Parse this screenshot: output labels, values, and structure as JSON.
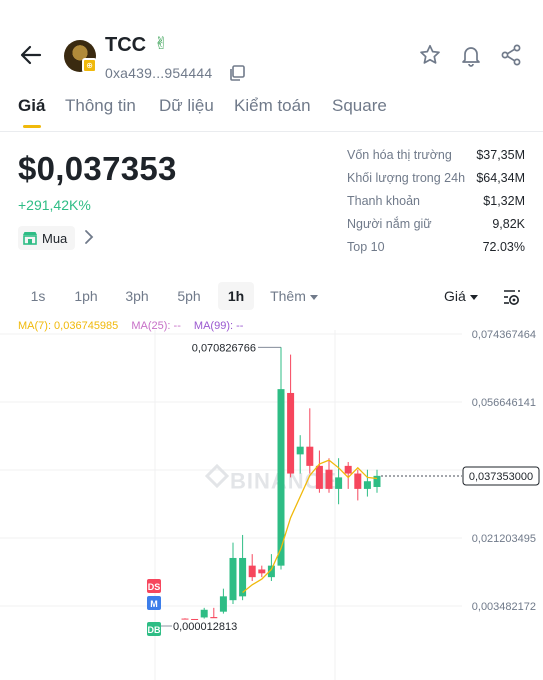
{
  "header": {
    "token_name": "TCC",
    "address": "0xa439...954444",
    "badge_glyph": "⊕",
    "hand_glyph": "✌"
  },
  "tabs": [
    {
      "label": "Giá",
      "active": true
    },
    {
      "label": "Thông tin",
      "active": false
    },
    {
      "label": "Dữ liệu",
      "active": false
    },
    {
      "label": "Kiểm toán",
      "active": false
    },
    {
      "label": "Square",
      "active": false
    }
  ],
  "price": {
    "value": "$0,037353",
    "change": "+291,42K%",
    "buy_label": "Mua"
  },
  "stats": [
    {
      "label": "Vốn hóa thị trường",
      "value": "$37,35M"
    },
    {
      "label": "Khối lượng trong 24h",
      "value": "$64,34M"
    },
    {
      "label": "Thanh khoản",
      "value": "$1,32M"
    },
    {
      "label": "Người nắm giữ",
      "value": "9,82K"
    },
    {
      "label": "Top 10",
      "value": "72.03%"
    }
  ],
  "intervals": [
    {
      "label": "1s",
      "active": false
    },
    {
      "label": "1ph",
      "active": false
    },
    {
      "label": "3ph",
      "active": false
    },
    {
      "label": "5ph",
      "active": false
    },
    {
      "label": "1h",
      "active": true
    },
    {
      "label": "Thêm",
      "active": false
    }
  ],
  "price_selector": "Giá",
  "ma": {
    "ma7": "MA(7): 0,036745985",
    "ma25": "MA(25): --",
    "ma99": "MA(99): --"
  },
  "colors": {
    "up": "#2ebd85",
    "down": "#f6465d",
    "accent": "#f0b90b",
    "ma7": "#f0b90b",
    "ma25": "#c770c7",
    "ma99": "#9b59d0",
    "marker_ds": "#f6465d",
    "marker_m": "#3d7eea",
    "marker_db": "#2ebd85"
  },
  "chart_data": {
    "type": "candlestick",
    "watermark": "BINANCE",
    "y_axis_labels": [
      "0,074367464",
      "0,056646141",
      "0,038924818",
      "0,021203495",
      "0,003482172"
    ],
    "y_axis_values": [
      0.074367464,
      0.056646141,
      0.038924818,
      0.021203495,
      0.003482172
    ],
    "current_price": 0.037353,
    "current_price_label": "0,037353000",
    "high_label": "0,070826766",
    "low_label": "0,000012813",
    "markers": [
      "DS",
      "M",
      "DB"
    ],
    "candles": [
      {
        "o": 0.0002,
        "h": 0.0003,
        "l": 1e-05,
        "c": 0.0001
      },
      {
        "o": 0.0001,
        "h": 0.0001,
        "l": 1e-05,
        "c": 5e-05
      },
      {
        "o": 0.0005,
        "h": 0.003,
        "l": 0.0002,
        "c": 0.0025
      },
      {
        "o": 0.0006,
        "h": 0.003,
        "l": 0.0004,
        "c": 0.0003
      },
      {
        "o": 0.002,
        "h": 0.008,
        "l": 0.0015,
        "c": 0.006
      },
      {
        "o": 0.005,
        "h": 0.02,
        "l": 0.004,
        "c": 0.016
      },
      {
        "o": 0.006,
        "h": 0.022,
        "l": 0.005,
        "c": 0.016
      },
      {
        "o": 0.014,
        "h": 0.017,
        "l": 0.01,
        "c": 0.011
      },
      {
        "o": 0.013,
        "h": 0.014,
        "l": 0.011,
        "c": 0.012
      },
      {
        "o": 0.011,
        "h": 0.017,
        "l": 0.01,
        "c": 0.014
      },
      {
        "o": 0.014,
        "h": 0.0709,
        "l": 0.013,
        "c": 0.06
      },
      {
        "o": 0.059,
        "h": 0.069,
        "l": 0.037,
        "c": 0.038
      },
      {
        "o": 0.043,
        "h": 0.048,
        "l": 0.038,
        "c": 0.045
      },
      {
        "o": 0.045,
        "h": 0.055,
        "l": 0.038,
        "c": 0.04
      },
      {
        "o": 0.04,
        "h": 0.044,
        "l": 0.033,
        "c": 0.034
      },
      {
        "o": 0.039,
        "h": 0.042,
        "l": 0.033,
        "c": 0.034
      },
      {
        "o": 0.034,
        "h": 0.042,
        "l": 0.03,
        "c": 0.037
      },
      {
        "o": 0.04,
        "h": 0.041,
        "l": 0.034,
        "c": 0.038
      },
      {
        "o": 0.038,
        "h": 0.039,
        "l": 0.031,
        "c": 0.034
      },
      {
        "o": 0.034,
        "h": 0.039,
        "l": 0.032,
        "c": 0.036
      },
      {
        "o": 0.0345,
        "h": 0.039,
        "l": 0.033,
        "c": 0.0374
      }
    ],
    "ma7_values": [
      null,
      null,
      null,
      null,
      null,
      null,
      0.007,
      0.009,
      0.0105,
      0.013,
      0.0185,
      0.0265,
      0.032,
      0.0375,
      0.0405,
      0.0415,
      0.0395,
      0.037,
      0.0395,
      0.037,
      0.0367
    ]
  }
}
